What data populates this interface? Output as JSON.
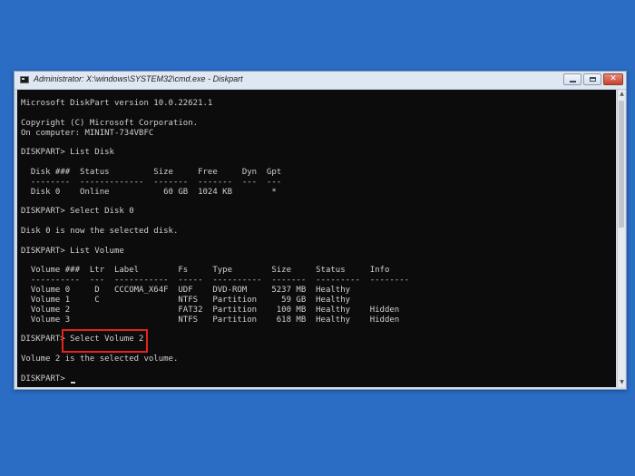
{
  "window": {
    "title": "Administrator: X:\\windows\\SYSTEM32\\cmd.exe - Diskpart"
  },
  "console": {
    "lines": [
      "Microsoft DiskPart version 10.0.22621.1",
      "",
      "Copyright (C) Microsoft Corporation.",
      "On computer: MININT-734VBFC",
      "",
      "DISKPART> List Disk",
      "",
      "  Disk ###  Status         Size     Free     Dyn  Gpt",
      "  --------  -------------  -------  -------  ---  ---",
      "  Disk 0    Online           60 GB  1024 KB        *",
      "",
      "DISKPART> Select Disk 0",
      "",
      "Disk 0 is now the selected disk.",
      "",
      "DISKPART> List Volume",
      "",
      "  Volume ###  Ltr  Label        Fs     Type        Size     Status     Info",
      "  ----------  ---  -----------  -----  ----------  -------  ---------  --------",
      "  Volume 0     D   CCCOMA_X64F  UDF    DVD-ROM     5237 MB  Healthy",
      "  Volume 1     C                NTFS   Partition     59 GB  Healthy",
      "  Volume 2                      FAT32  Partition    100 MB  Healthy    Hidden",
      "  Volume 3                      NTFS   Partition    618 MB  Healthy    Hidden",
      "",
      "DISKPART> Select Volume 2",
      "",
      "Volume 2 is the selected volume.",
      ""
    ],
    "prompt": "DISKPART> "
  },
  "colors": {
    "desktop": "#2b6cc4",
    "console_bg": "#0c0c0c",
    "console_text": "#d0d0d0",
    "highlight": "#e0241e"
  },
  "icons": {
    "app": "cmd-icon",
    "minimize": "minimize-icon",
    "maximize": "maximize-icon",
    "close": "close-icon"
  }
}
